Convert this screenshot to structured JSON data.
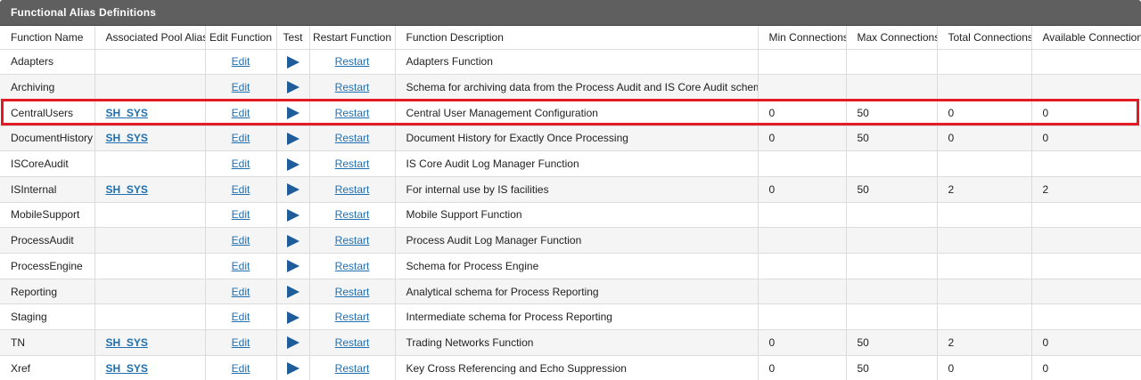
{
  "panel": {
    "title": "Functional Alias Definitions"
  },
  "columns": [
    "Function Name",
    "Associated Pool Alias",
    "Edit Function",
    "Test",
    "Restart Function",
    "Function Description",
    "Min Connections",
    "Max Connections",
    "Total Connections",
    "Available Connections"
  ],
  "rows": [
    {
      "name": "Adapters",
      "pool": "",
      "edit": "Edit",
      "test_icon": "play-icon",
      "restart": "Restart",
      "description": "Adapters Function",
      "min": "",
      "max": "",
      "total": "",
      "available": ""
    },
    {
      "name": "Archiving",
      "pool": "",
      "edit": "Edit",
      "test_icon": "play-icon",
      "restart": "Restart",
      "description": "Schema for archiving data from the Process Audit and IS Core Audit schemas",
      "min": "",
      "max": "",
      "total": "",
      "available": ""
    },
    {
      "name": "CentralUsers",
      "pool": "SH_SYS",
      "edit": "Edit",
      "test_icon": "play-icon",
      "restart": "Restart",
      "description": "Central User Management Configuration",
      "min": "0",
      "max": "50",
      "total": "0",
      "available": "0"
    },
    {
      "name": "DocumentHistory",
      "pool": "SH_SYS",
      "edit": "Edit",
      "test_icon": "play-icon",
      "restart": "Restart",
      "description": "Document History for Exactly Once Processing",
      "min": "0",
      "max": "50",
      "total": "0",
      "available": "0"
    },
    {
      "name": "ISCoreAudit",
      "pool": "",
      "edit": "Edit",
      "test_icon": "play-icon",
      "restart": "Restart",
      "description": "IS Core Audit Log Manager Function",
      "min": "",
      "max": "",
      "total": "",
      "available": ""
    },
    {
      "name": "ISInternal",
      "pool": "SH_SYS",
      "edit": "Edit",
      "test_icon": "play-icon",
      "restart": "Restart",
      "description": "For internal use by IS facilities",
      "min": "0",
      "max": "50",
      "total": "2",
      "available": "2"
    },
    {
      "name": "MobileSupport",
      "pool": "",
      "edit": "Edit",
      "test_icon": "play-icon",
      "restart": "Restart",
      "description": "Mobile Support Function",
      "min": "",
      "max": "",
      "total": "",
      "available": ""
    },
    {
      "name": "ProcessAudit",
      "pool": "",
      "edit": "Edit",
      "test_icon": "play-icon",
      "restart": "Restart",
      "description": "Process Audit Log Manager Function",
      "min": "",
      "max": "",
      "total": "",
      "available": ""
    },
    {
      "name": "ProcessEngine",
      "pool": "",
      "edit": "Edit",
      "test_icon": "play-icon",
      "restart": "Restart",
      "description": "Schema for Process Engine",
      "min": "",
      "max": "",
      "total": "",
      "available": ""
    },
    {
      "name": "Reporting",
      "pool": "",
      "edit": "Edit",
      "test_icon": "play-icon",
      "restart": "Restart",
      "description": "Analytical schema for Process Reporting",
      "min": "",
      "max": "",
      "total": "",
      "available": ""
    },
    {
      "name": "Staging",
      "pool": "",
      "edit": "Edit",
      "test_icon": "play-icon",
      "restart": "Restart",
      "description": "Intermediate schema for Process Reporting",
      "min": "",
      "max": "",
      "total": "",
      "available": ""
    },
    {
      "name": "TN",
      "pool": "SH_SYS",
      "edit": "Edit",
      "test_icon": "play-icon",
      "restart": "Restart",
      "description": "Trading Networks Function",
      "min": "0",
      "max": "50",
      "total": "2",
      "available": "0"
    },
    {
      "name": "Xref",
      "pool": "SH_SYS",
      "edit": "Edit",
      "test_icon": "play-icon",
      "restart": "Restart",
      "description": "Key Cross Referencing and Echo Suppression",
      "min": "0",
      "max": "50",
      "total": "0",
      "available": "0"
    }
  ],
  "highlighted_row": "CentralUsers",
  "colors": {
    "header_bg": "#5f5f5f",
    "link": "#1f6fb0",
    "play_icon": "#1e5c9a",
    "highlight_border": "#e21b25"
  }
}
